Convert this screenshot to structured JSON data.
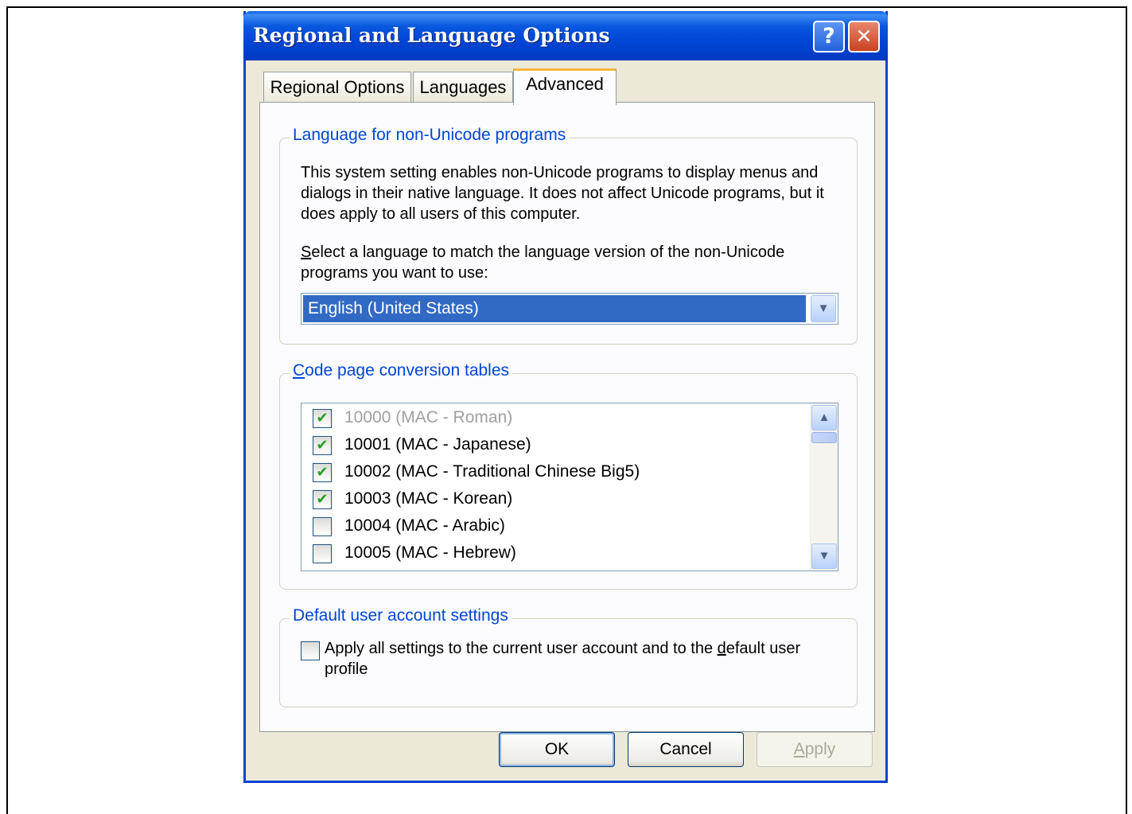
{
  "dialog": {
    "title": "Regional and Language Options",
    "help_glyph": "?",
    "close_glyph": "✕"
  },
  "tabs": [
    {
      "label": "Regional Options"
    },
    {
      "label": "Languages"
    },
    {
      "label": "Advanced",
      "active": true
    }
  ],
  "non_unicode": {
    "title": "Language for non-Unicode programs",
    "description": "This system setting enables non-Unicode programs to display menus and dialogs in their native language. It does not affect Unicode programs, but it does apply to all users of this computer.",
    "prompt_first": "S",
    "prompt_rest": "elect a language to match the language version of the non-Unicode programs you want to use:",
    "selected_language": "English (United States)"
  },
  "code_pages": {
    "title_first": "C",
    "title_rest": "ode page conversion tables",
    "items": [
      {
        "label": "10000 (MAC - Roman)",
        "checked": true,
        "disabled": true
      },
      {
        "label": "10001 (MAC - Japanese)",
        "checked": true,
        "disabled": false
      },
      {
        "label": "10002 (MAC - Traditional Chinese Big5)",
        "checked": true,
        "disabled": false
      },
      {
        "label": "10003 (MAC - Korean)",
        "checked": true,
        "disabled": false
      },
      {
        "label": "10004 (MAC - Arabic)",
        "checked": false,
        "disabled": false
      },
      {
        "label": "10005 (MAC - Hebrew)",
        "checked": false,
        "disabled": false
      }
    ]
  },
  "default_user": {
    "title": "Default user account settings",
    "label_before": "Apply all settings to the current user account and to the ",
    "label_access": "d",
    "label_after": "efault user profile",
    "checked": false
  },
  "buttons": {
    "ok": "OK",
    "cancel": "Cancel",
    "apply_first": "A",
    "apply_rest": "pply"
  },
  "colors": {
    "title_bar": "#0046d5",
    "group_title": "#0046d5",
    "selection": "#316ac5",
    "checkmark": "#21a121"
  },
  "icons": {
    "help": "help-icon",
    "close": "close-icon",
    "dropdown": "chevron-down-icon",
    "scroll_up": "chevron-up-icon",
    "scroll_down": "chevron-down-icon"
  }
}
